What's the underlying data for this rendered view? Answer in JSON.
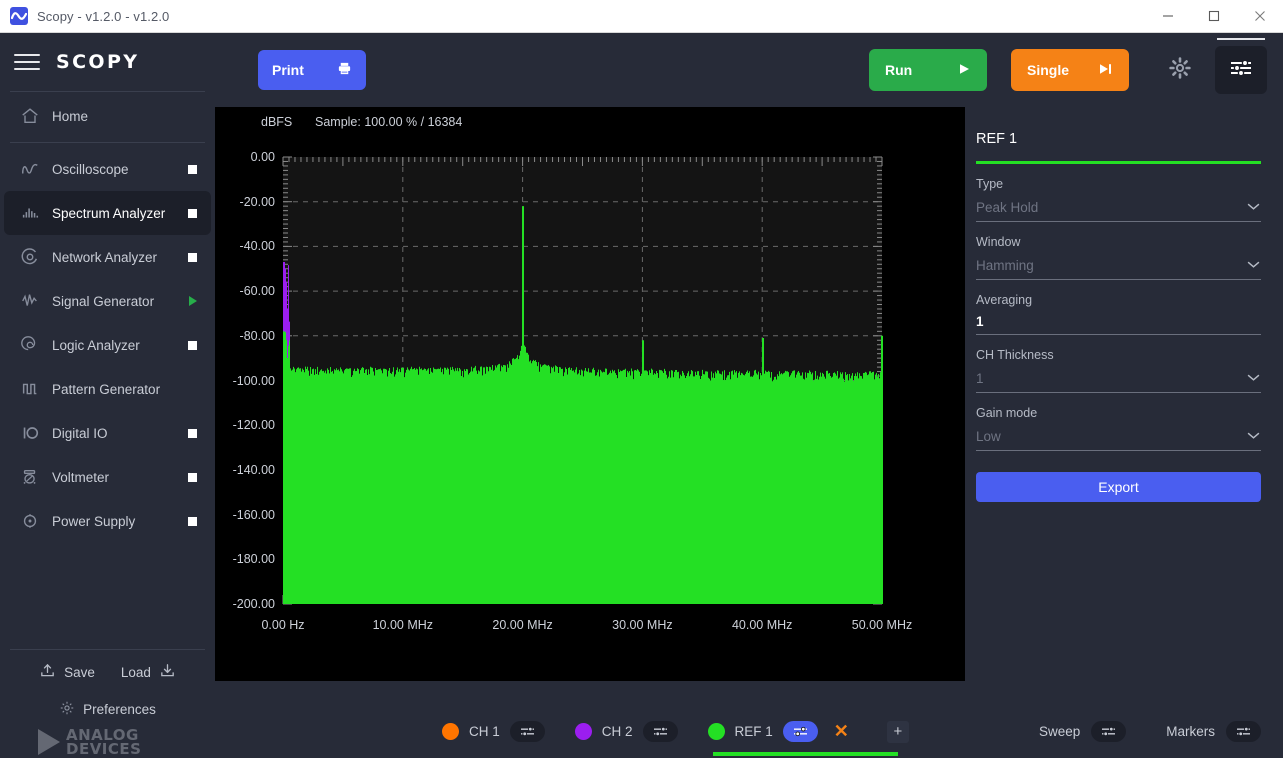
{
  "window": {
    "title": "Scopy - v1.2.0 - v1.2.0",
    "app_icon": "waveform-icon",
    "minimize": "−",
    "maximize": "□",
    "close": "✕"
  },
  "sidebar": {
    "brand": "SCOPY",
    "menu_icon": "hamburger-icon",
    "items": [
      {
        "label": "Home",
        "icon": "home-icon",
        "status": "none",
        "active": false
      },
      {
        "label": "Oscilloscope",
        "icon": "oscilloscope-icon",
        "status": "square",
        "active": false
      },
      {
        "label": "Spectrum Analyzer",
        "icon": "spectrum-analyzer-icon",
        "status": "square",
        "active": true
      },
      {
        "label": "Network Analyzer",
        "icon": "network-analyzer-icon",
        "status": "square",
        "active": false
      },
      {
        "label": "Signal Generator",
        "icon": "signal-generator-icon",
        "status": "triangle",
        "active": false
      },
      {
        "label": "Logic Analyzer",
        "icon": "logic-analyzer-icon",
        "status": "square",
        "active": false
      },
      {
        "label": "Pattern Generator",
        "icon": "pattern-generator-icon",
        "status": "none",
        "active": false
      },
      {
        "label": "Digital IO",
        "icon": "digital-io-icon",
        "status": "square",
        "active": false
      },
      {
        "label": "Voltmeter",
        "icon": "voltmeter-icon",
        "status": "square",
        "active": false
      },
      {
        "label": "Power Supply",
        "icon": "power-supply-icon",
        "status": "square",
        "active": false
      }
    ],
    "save_label": "Save",
    "load_label": "Load",
    "preferences_label": "Preferences",
    "vendor_line1": "ANALOG",
    "vendor_line2": "DEVICES"
  },
  "toolbar": {
    "print_label": "Print",
    "print_icon": "printer-icon",
    "run_label": "Run",
    "run_icon": "play-icon",
    "single_label": "Single",
    "single_icon": "step-forward-icon",
    "settings_icon": "gear-icon",
    "panel_icon": "sliders-icon"
  },
  "right_panel": {
    "title": "REF 1",
    "accent": "#24e024",
    "fields": [
      {
        "label": "Type",
        "value": "Peak Hold",
        "control": "dropdown",
        "dim": true
      },
      {
        "label": "Window",
        "value": "Hamming",
        "control": "dropdown",
        "dim": true
      },
      {
        "label": "Averaging",
        "value": "1",
        "control": "text",
        "dim": false
      },
      {
        "label": "CH Thickness",
        "value": "1",
        "control": "dropdown",
        "dim": true
      },
      {
        "label": "Gain mode",
        "value": "Low",
        "control": "dropdown",
        "dim": true
      }
    ],
    "export_label": "Export"
  },
  "bottom_bar": {
    "channels": [
      {
        "name": "CH 1",
        "color": "#ff7500",
        "settings_icon": "sliders-icon",
        "settings_active": false,
        "closable": false
      },
      {
        "name": "CH 2",
        "color": "#9b1ef0",
        "settings_icon": "sliders-icon",
        "settings_active": false,
        "closable": false
      },
      {
        "name": "REF 1",
        "color": "#24e024",
        "settings_icon": "sliders-icon",
        "settings_active": true,
        "closable": true,
        "close_icon": "close-icon"
      }
    ],
    "add_label": "+",
    "sweep_label": "Sweep",
    "sweep_icon": "sliders-icon",
    "markers_label": "Markers",
    "markers_icon": "sliders-icon"
  },
  "chart_data": {
    "type": "line",
    "title": "",
    "subtitle": "Sample: 100.00 % / 16384",
    "ylabel": "dBFS",
    "xlabel": "",
    "xlim": [
      0,
      50
    ],
    "ylim": [
      -200,
      0
    ],
    "x_unit": "MHz",
    "grid": true,
    "legend_position": "bottom",
    "x_ticks": [
      {
        "value": 0,
        "label": "0.00 Hz"
      },
      {
        "value": 10,
        "label": "10.00 MHz"
      },
      {
        "value": 20,
        "label": "20.00 MHz"
      },
      {
        "value": 30,
        "label": "30.00 MHz"
      },
      {
        "value": 40,
        "label": "40.00 MHz"
      },
      {
        "value": 50,
        "label": "50.00 MHz"
      }
    ],
    "y_ticks": [
      {
        "value": 0,
        "label": "0.00"
      },
      {
        "value": -20,
        "label": "-20.00"
      },
      {
        "value": -40,
        "label": "-40.00"
      },
      {
        "value": -60,
        "label": "-60.00"
      },
      {
        "value": -80,
        "label": "-80.00"
      },
      {
        "value": -100,
        "label": "-100.00"
      },
      {
        "value": -120,
        "label": "-120.00"
      },
      {
        "value": -140,
        "label": "-140.00"
      },
      {
        "value": -160,
        "label": "-160.00"
      },
      {
        "value": -180,
        "label": "-180.00"
      },
      {
        "value": -200,
        "label": "-200.00"
      }
    ],
    "series": [
      {
        "name": "REF 1",
        "color": "#24e024",
        "noise_floor": -95,
        "noise_jitter": 4,
        "dc_level": -78,
        "peaks": [
          {
            "freq": 20.0,
            "amplitude": -22
          },
          {
            "freq": 30.0,
            "amplitude": -82
          },
          {
            "freq": 40.0,
            "amplitude": -81
          },
          {
            "freq": 50.0,
            "amplitude": -80
          }
        ],
        "skirt_center": 20.0,
        "skirt_width": 9.0,
        "skirt_amplitude": 14
      },
      {
        "name": "CH 1",
        "color": "#ff7500",
        "noise_floor": -104,
        "noise_jitter": 11,
        "dc_level": -84,
        "peaks": [],
        "skirt_center": 20.0,
        "skirt_width": 8.0,
        "skirt_amplitude": 10
      },
      {
        "name": "CH 2",
        "color": "#9b1ef0",
        "noise_floor": -116,
        "noise_jitter": 24,
        "dc_level": -47,
        "peaks": [
          {
            "freq": 20.0,
            "amplitude": -86
          }
        ],
        "skirt_center": 20.0,
        "skirt_width": 2.0,
        "skirt_amplitude": 22
      }
    ]
  }
}
